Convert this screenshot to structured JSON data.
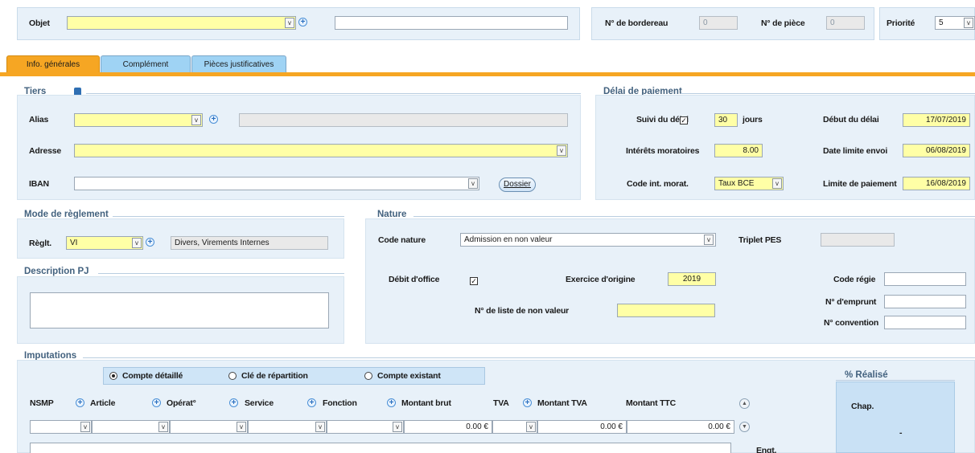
{
  "header": {
    "objet_label": "Objet",
    "objet_value": "",
    "objet_text": "",
    "bordereau_label": "N° de bordereau",
    "bordereau_value": "0",
    "piece_label": "N° de pièce",
    "piece_value": "0",
    "priorite_label": "Priorité",
    "priorite_value": "5"
  },
  "tabs": [
    {
      "label": "Info. générales",
      "active": true
    },
    {
      "label": "Complément",
      "active": false
    },
    {
      "label": "Pièces justificatives",
      "active": false
    }
  ],
  "tiers": {
    "title": "Tiers",
    "alias_label": "Alias",
    "alias_value": "",
    "alias_desc": "",
    "adresse_label": "Adresse",
    "adresse_value": "",
    "iban_label": "IBAN",
    "iban_value": "",
    "dossier_button": "Dossier"
  },
  "delai": {
    "title": "Délai de paiement",
    "suivi_label": "Suivi du délai",
    "suivi_checked": true,
    "jours_value": "30",
    "jours_unit": "jours",
    "debut_label": "Début du délai",
    "debut_value": "17/07/2019",
    "interets_label": "Intérêts moratoires",
    "interets_value": "8.00",
    "date_limite_label": "Date limite envoi",
    "date_limite_value": "06/08/2019",
    "code_label": "Code int. morat.",
    "code_value": "Taux BCE",
    "limite_label": "Limite de paiement",
    "limite_value": "16/08/2019"
  },
  "mode": {
    "title": "Mode de règlement",
    "reglt_label": "Règlt.",
    "reglt_value": "VI",
    "reglt_desc": "Divers, Virements Internes"
  },
  "description": {
    "title": "Description PJ",
    "value": ""
  },
  "nature": {
    "title": "Nature",
    "code_label": "Code nature",
    "code_value": "Admission en non valeur",
    "triplet_label": "Triplet PES",
    "triplet_value": "",
    "debit_label": "Débit d'office",
    "debit_checked": true,
    "exercice_label": "Exercice d'origine",
    "exercice_value": "2019",
    "regie_label": "Code régie",
    "regie_value": "",
    "liste_label": "N° de liste de non valeur",
    "liste_value": "",
    "emprunt_label": "N° d'emprunt",
    "emprunt_value": "",
    "convention_label": "N° convention",
    "convention_value": ""
  },
  "imputations": {
    "title": "Imputations",
    "radios": [
      {
        "label": "Compte détaillé",
        "selected": true
      },
      {
        "label": "Clé de répartition",
        "selected": false
      },
      {
        "label": "Compte existant",
        "selected": false
      }
    ],
    "columns": [
      "NSMP",
      "Article",
      "Opérat°",
      "Service",
      "Fonction",
      "Montant brut",
      "TVA",
      "Montant TVA",
      "Montant TTC"
    ],
    "row": {
      "montant_brut": "0.00 €",
      "montant_tva": "0.00 €",
      "montant_ttc": "0.00 €"
    },
    "realise_title": "% Réalisé",
    "chap_label": "Chap.",
    "chap_value": "-",
    "engt_label": "Engt."
  },
  "colors": {
    "yellow_field": "#ffffa6",
    "panel_bg": "#e8f1f9",
    "tab_active": "#f6a623",
    "tab_inactive": "#9fd3f4",
    "accent_bar": "#f6a623"
  }
}
